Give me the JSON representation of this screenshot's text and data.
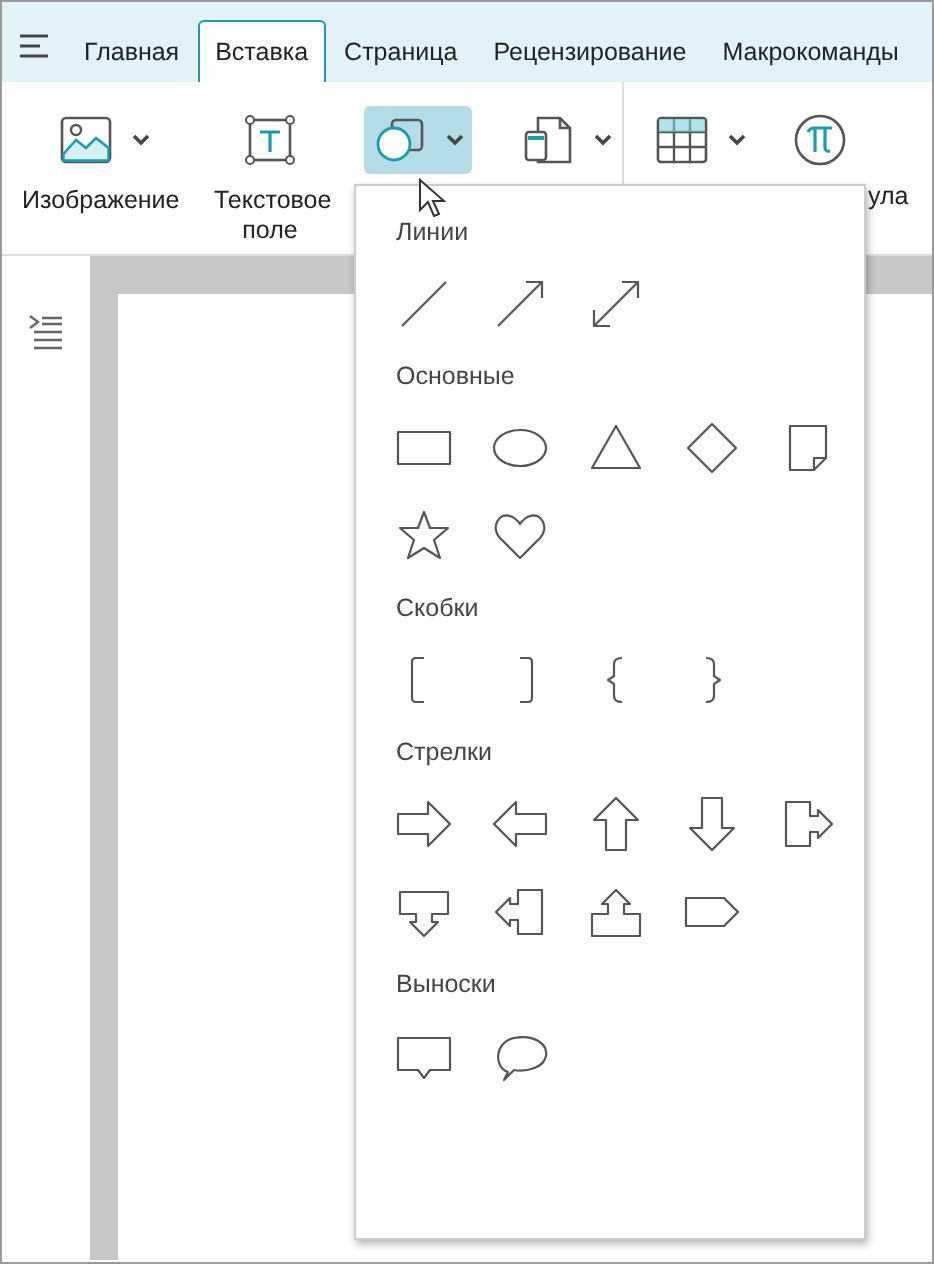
{
  "tabs": [
    {
      "label": "Главная",
      "selected": false
    },
    {
      "label": "Вставка",
      "selected": true
    },
    {
      "label": "Страница",
      "selected": false
    },
    {
      "label": "Рецензирование",
      "selected": false
    },
    {
      "label": "Макрокоманды",
      "selected": false
    }
  ],
  "ribbon": [
    {
      "kind": "image",
      "label": "Изображение",
      "selected": false,
      "caret": true
    },
    {
      "kind": "textbox",
      "label": "Текстовое поле",
      "selected": false,
      "caret": false
    },
    {
      "kind": "shapes",
      "selected": true,
      "caret": true
    },
    {
      "kind": "page",
      "selected": false,
      "caret": true
    },
    {
      "kind": "table",
      "selected": false,
      "caret": true
    },
    {
      "kind": "formula",
      "label": "ула",
      "selected": false,
      "caret": false
    }
  ],
  "shapes_menu": [
    {
      "title": "Линии",
      "shapes": [
        {
          "kind": "line"
        },
        {
          "kind": "arrow"
        },
        {
          "kind": "double-arrow"
        }
      ]
    },
    {
      "title": "Основные",
      "shapes": [
        {
          "kind": "rectangle"
        },
        {
          "kind": "ellipse"
        },
        {
          "kind": "triangle"
        },
        {
          "kind": "diamond"
        },
        {
          "kind": "note"
        },
        {
          "kind": "star"
        },
        {
          "kind": "heart"
        }
      ]
    },
    {
      "title": "Скобки",
      "shapes": [
        {
          "kind": "left-bracket"
        },
        {
          "kind": "right-bracket"
        },
        {
          "kind": "left-brace"
        },
        {
          "kind": "right-brace"
        }
      ]
    },
    {
      "title": "Стрелки",
      "shapes": [
        {
          "kind": "right-arrow"
        },
        {
          "kind": "left-arrow"
        },
        {
          "kind": "up-arrow"
        },
        {
          "kind": "down-arrow"
        },
        {
          "kind": "right-callout-arrow"
        },
        {
          "kind": "down-callout-arrow"
        },
        {
          "kind": "left-callout-arrow"
        },
        {
          "kind": "up-callout-arrow"
        },
        {
          "kind": "pentagon"
        }
      ]
    },
    {
      "title": "Выноски",
      "shapes": [
        {
          "kind": "rect-callout"
        },
        {
          "kind": "oval-callout"
        }
      ]
    }
  ]
}
